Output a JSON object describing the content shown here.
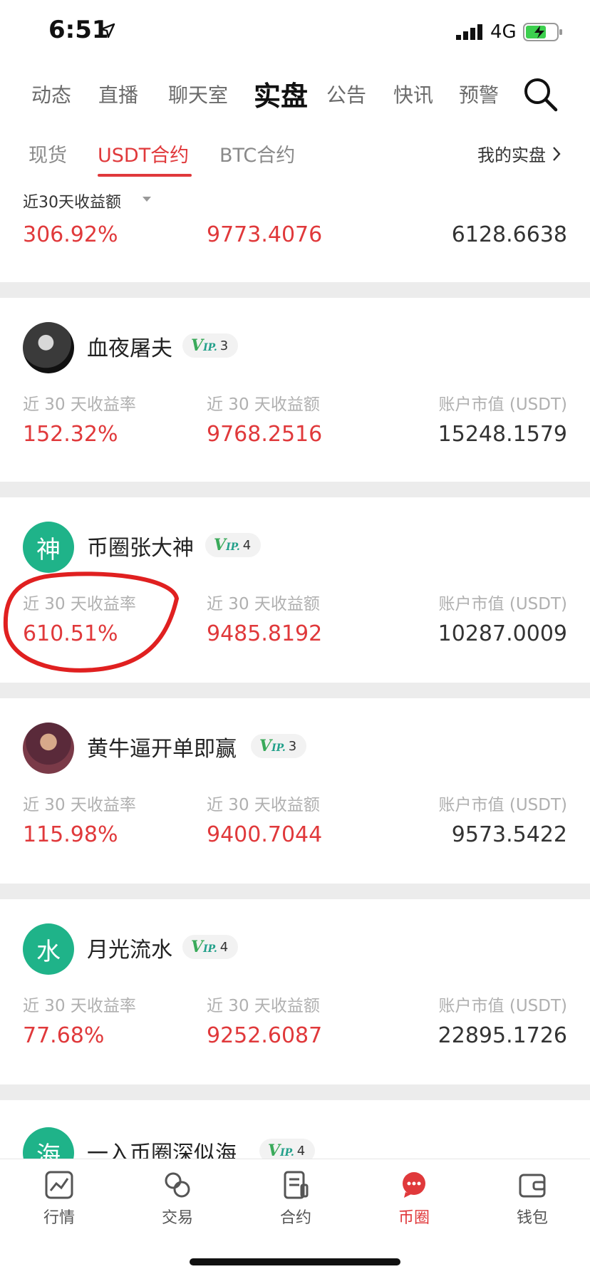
{
  "status": {
    "time": "6:51",
    "network": "4G"
  },
  "top_nav": {
    "tabs": [
      "动态",
      "直播",
      "聊天室",
      "实盘",
      "公告",
      "快讯",
      "预警"
    ],
    "active": "实盘"
  },
  "sub_nav": {
    "tabs": [
      "现货",
      "USDT合约",
      "BTC合约"
    ],
    "active": "USDT合约",
    "my_link": "我的实盘"
  },
  "summary": {
    "sort_label": "近30天收益额",
    "values": [
      "306.92%",
      "9773.4076",
      "6128.6638"
    ]
  },
  "columns": {
    "rate": "近 30 天收益率",
    "profit": "近 30 天收益额",
    "account": "账户市值 (USDT)"
  },
  "traders": [
    {
      "name": "血夜屠夫",
      "avatar": "",
      "vip": "3",
      "rate": "152.32%",
      "profit": "9768.2516",
      "account": "15248.1579"
    },
    {
      "name": "币圈张大神",
      "avatar": "神",
      "vip": "4",
      "rate": "610.51%",
      "profit": "9485.8192",
      "account": "10287.0009"
    },
    {
      "name": "黄牛逼开单即赢",
      "avatar": "",
      "vip": "3",
      "rate": "115.98%",
      "profit": "9400.7044",
      "account": "9573.5422"
    },
    {
      "name": "月光流水",
      "avatar": "水",
      "vip": "4",
      "rate": "77.68%",
      "profit": "9252.6087",
      "account": "22895.1726"
    },
    {
      "name": "一入币圈深似海",
      "avatar": "海",
      "vip": "4"
    }
  ],
  "vip_text": "VIP",
  "tab_bar": [
    {
      "label": "行情",
      "icon": "chart-icon"
    },
    {
      "label": "交易",
      "icon": "exchange-icon"
    },
    {
      "label": "合约",
      "icon": "document-icon"
    },
    {
      "label": "币圈",
      "icon": "chat-icon"
    },
    {
      "label": "钱包",
      "icon": "wallet-icon"
    }
  ],
  "colors": {
    "accent": "#e0393b",
    "green": "#1fb389",
    "muted": "#b0b0b0"
  }
}
